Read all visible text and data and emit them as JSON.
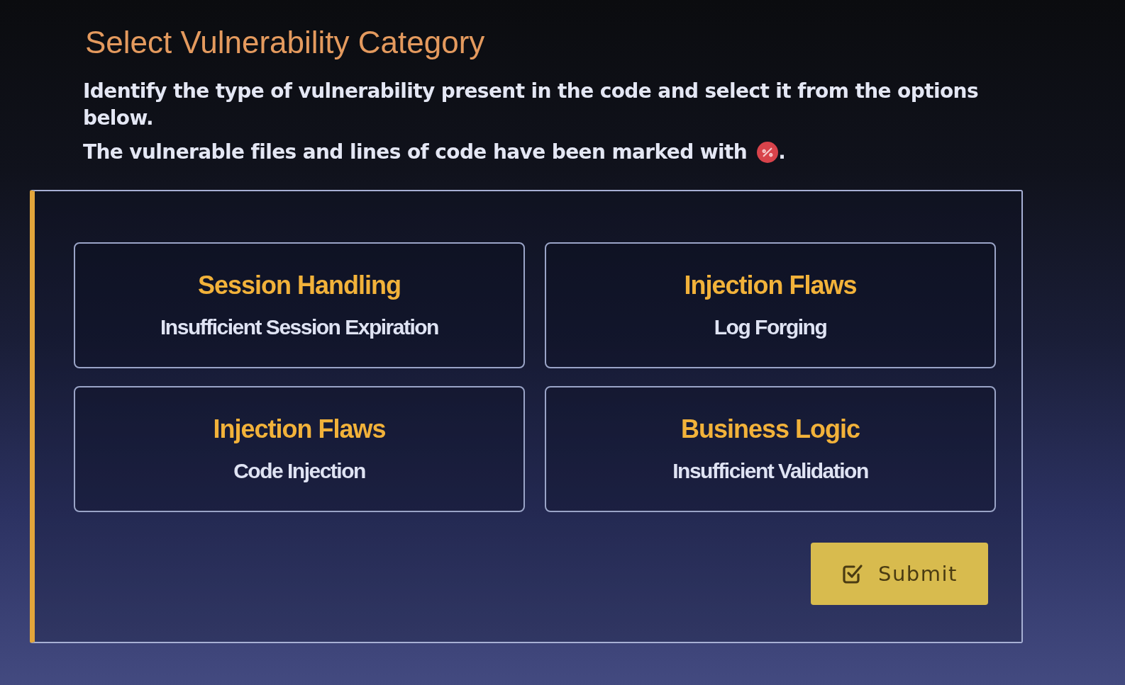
{
  "title": "Select Vulnerability Category",
  "instructions": "Identify the type of vulnerability present in the code and select it from the options below.",
  "marker_note": {
    "text": "The vulnerable files and lines of code have been marked with",
    "end": "."
  },
  "options": [
    {
      "category": "Session Handling",
      "name": "Insufficient Session Expiration",
      "selected": false
    },
    {
      "category": "Injection Flaws",
      "name": "Log Forging",
      "selected": false
    },
    {
      "category": "Injection Flaws",
      "name": "Code Injection",
      "selected": false
    },
    {
      "category": "Business Logic",
      "name": "Insufficient Validation",
      "selected": false
    }
  ],
  "submit": {
    "label": "Submit"
  }
}
